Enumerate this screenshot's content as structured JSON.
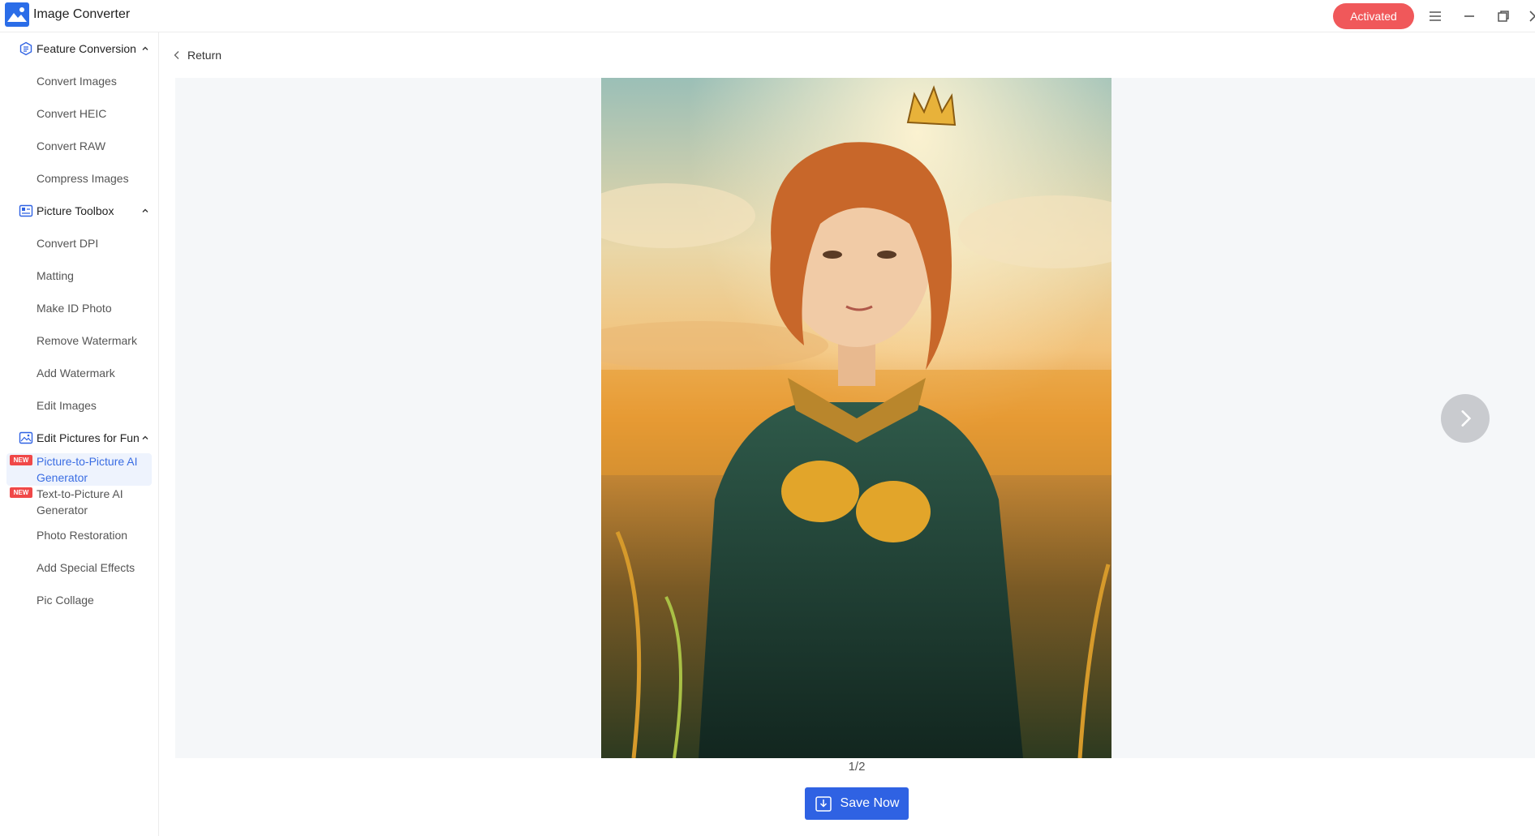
{
  "app": {
    "title": "Image Converter",
    "activated_label": "Activated",
    "accent_color": "#2f62e3",
    "activated_color": "#f0585a"
  },
  "window_controls": [
    "menu-icon",
    "minimize-icon",
    "restore-icon",
    "close-icon"
  ],
  "sidebar": {
    "groups": [
      {
        "label": "Feature Conversion",
        "icon": "feature-conversion-icon",
        "items": [
          {
            "label": "Convert Images"
          },
          {
            "label": "Convert HEIC"
          },
          {
            "label": "Convert RAW"
          },
          {
            "label": "Compress Images"
          }
        ]
      },
      {
        "label": "Picture Toolbox",
        "icon": "picture-toolbox-icon",
        "items": [
          {
            "label": "Convert DPI"
          },
          {
            "label": "Matting"
          },
          {
            "label": "Make ID Photo"
          },
          {
            "label": "Remove Watermark"
          },
          {
            "label": "Add Watermark"
          },
          {
            "label": "Edit Images"
          }
        ]
      },
      {
        "label": "Edit Pictures for Fun",
        "icon": "edit-pictures-icon",
        "items": [
          {
            "label": "Picture-to-Picture AI Generator",
            "badge": "NEW",
            "active": true
          },
          {
            "label": "Text-to-Picture AI Generator",
            "badge": "NEW"
          },
          {
            "label": "Photo Restoration"
          },
          {
            "label": "Add Special Effects"
          },
          {
            "label": "Pic Collage"
          }
        ]
      }
    ]
  },
  "main": {
    "return_label": "Return",
    "page_counter": "1/2",
    "save_label": "Save Now"
  }
}
